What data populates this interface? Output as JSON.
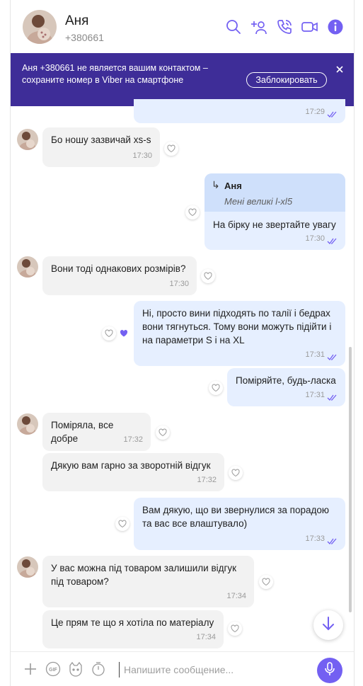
{
  "header": {
    "name": "Аня",
    "phone": "+380661"
  },
  "banner": {
    "text": "Аня +380661             не является вашим контактом – сохраните номер в Viber на смартфоне",
    "block_label": "Заблокировать"
  },
  "messages": {
    "m0": {
      "time": "17:29"
    },
    "m1": {
      "text": "Бо ношу зазвичай xs-s",
      "time": "17:30"
    },
    "m2": {
      "reply_name": "Аня",
      "reply_quote": "Мені великі l-xl5",
      "text": "На бірку не звертайте увагу",
      "time": "17:30"
    },
    "m3": {
      "text": "Вони тоді однакових розмірів?",
      "time": "17:30"
    },
    "m4": {
      "text": "Ні, просто вини підходять по талії і бедрах вони тягнуться. Тому вони можуть підійти і на параметри S і на XL",
      "time": "17:31"
    },
    "m5": {
      "text": "Поміряйте, будь-ласка",
      "time": "17:31"
    },
    "m6": {
      "text": "Поміряла, все добре",
      "time": "17:32"
    },
    "m7": {
      "text": "Дякую вам гарно за зворотній відгук",
      "time": "17:32"
    },
    "m8": {
      "text": "Вам дякую, що ви звернулися за порадою та вас все влаштувало)",
      "time": "17:33"
    },
    "m9": {
      "text": "У вас можна під товаром залишили відгук під товаром?",
      "time": "17:34"
    },
    "m10": {
      "text": "Це прям те що я хотіла по матеріалу",
      "time": "17:34"
    }
  },
  "composer": {
    "placeholder": "Напишите сообщение..."
  },
  "colors": {
    "accent": "#7360f2",
    "banner": "#3e2d98",
    "incoming_bubble": "#f2f2f2",
    "outgoing_bubble": "#e6efff",
    "reply_box": "#cfe0fb"
  },
  "icons": [
    "search-icon",
    "add-participant-icon",
    "call-icon",
    "video-call-icon",
    "info-icon",
    "close-icon",
    "heart-icon",
    "double-check-icon",
    "scroll-down-icon",
    "plus-icon",
    "gif-icon",
    "sticker-icon",
    "timer-icon",
    "microphone-icon"
  ]
}
